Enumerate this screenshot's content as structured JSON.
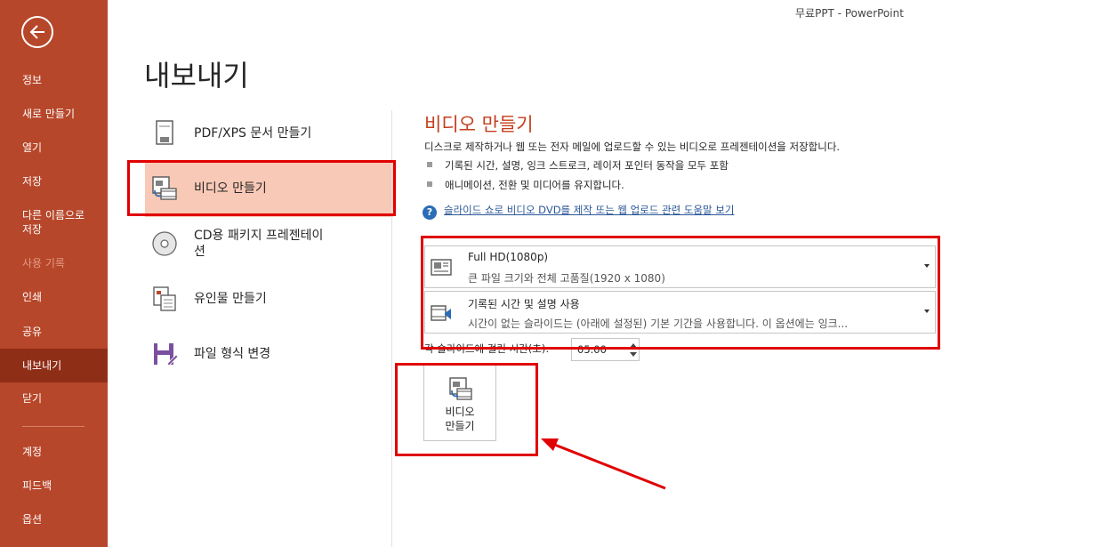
{
  "window": {
    "title": "무료PPT  -  PowerPoint"
  },
  "sidebar": {
    "back_icon": "back-arrow-icon",
    "items": [
      {
        "label": "정보",
        "state": "normal"
      },
      {
        "label": "새로 만들기",
        "state": "normal"
      },
      {
        "label": "열기",
        "state": "normal"
      },
      {
        "label": "저장",
        "state": "normal"
      },
      {
        "label": "다른 이름으로\n저장",
        "state": "normal"
      },
      {
        "label": "사용 기록",
        "state": "disabled"
      },
      {
        "label": "인쇄",
        "state": "normal"
      },
      {
        "label": "공유",
        "state": "normal"
      },
      {
        "label": "내보내기",
        "state": "active"
      },
      {
        "label": "닫기",
        "state": "normal"
      },
      {
        "label": "계정",
        "state": "normal"
      },
      {
        "label": "피드백",
        "state": "normal"
      },
      {
        "label": "옵션",
        "state": "normal"
      }
    ]
  },
  "page_title": "내보내기",
  "export_options": [
    {
      "label": "PDF/XPS 문서 만들기",
      "icon": "pdf-document-icon",
      "selected": false
    },
    {
      "label": "비디오 만들기",
      "icon": "video-icon",
      "selected": true
    },
    {
      "label": "CD용 패키지 프레젠테이\n션",
      "icon": "cd-icon",
      "selected": false
    },
    {
      "label": "유인물 만들기",
      "icon": "handout-icon",
      "selected": false
    },
    {
      "label": "파일 형식 변경",
      "icon": "save-file-icon",
      "selected": false
    }
  ],
  "video": {
    "title": "비디오 만들기",
    "description": "디스크로 제작하거나 웹 또는 전자 메일에 업로드할 수 있는 비디오로 프레젠테이션을 저장합니다.",
    "bullets": [
      "기록된 시간, 설명, 잉크 스트로크, 레이저 포인터 동작을 모두 포함",
      "애니메이션, 전환 및 미디어를 유지합니다."
    ],
    "help_link": "슬라이드 쇼로 비디오 DVD를 제작 또는 웹 업로드 관련 도움말 보기",
    "quality": {
      "main": "Full HD(1080p)",
      "sub": "큰 파일 크기와 전체 고품질(1920 x 1080)"
    },
    "timing": {
      "main": "기록된 시간 및 설명 사용",
      "sub": "시간이 없는 슬라이드는 (아래에 설정된) 기본 기간을 사용합니다. 이 옵션에는 잉크..."
    },
    "seconds_label": "각 슬라이드에 걸린 시간(초):",
    "seconds_value": "05.00",
    "create_button": "비디오\n만들기"
  },
  "colors": {
    "sidebar": "#b7472a",
    "sidebar_active": "#8f2e17",
    "selected_option": "#f8c9b6",
    "accent_title": "#c43e1c",
    "annotation": "#e00000"
  }
}
